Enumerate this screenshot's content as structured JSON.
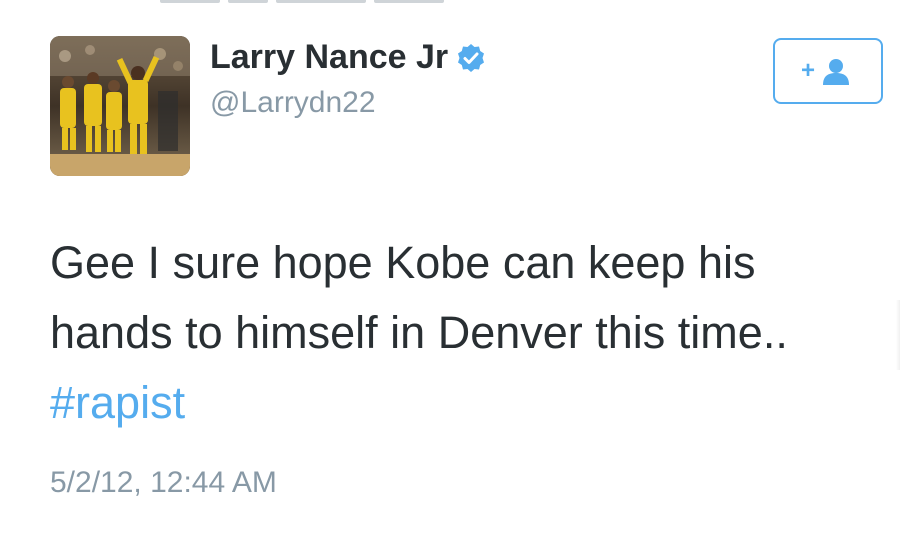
{
  "user": {
    "display_name": "Larry Nance Jr",
    "handle": "@Larrydn22",
    "verified": true,
    "avatar_icon": "basketball-team-photo"
  },
  "follow_button": {
    "icon": "add-user-icon",
    "symbol": "+"
  },
  "tweet": {
    "text_before": "Gee I sure hope Kobe can keep his hands to himself in Denver this time.. ",
    "hashtag": "#rapist",
    "timestamp": "5/2/12, 12:44 AM"
  },
  "colors": {
    "name": "#292f33",
    "secondary": "#8899a6",
    "accent": "#55acee"
  }
}
